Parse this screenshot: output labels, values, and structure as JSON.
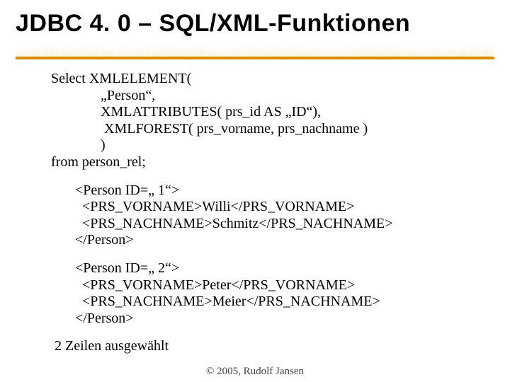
{
  "title": "JDBC 4. 0 – SQL/XML-Funktionen",
  "sql": {
    "l1": "Select XMLELEMENT(",
    "l2": "„Person“,",
    "l3": "XMLATTRIBUTES( prs_id AS „ID“),",
    "l4": " XMLFOREST( prs_vorname, prs_nachname )",
    "l5": ")",
    "l6": "from person_rel;"
  },
  "result1": {
    "open": "<Person ID=„ 1“>",
    "vor": "  <PRS_VORNAME>Willi</PRS_VORNAME>",
    "nach": "  <PRS_NACHNAME>Schmitz</PRS_NACHNAME>",
    "close": "</Person>"
  },
  "result2": {
    "open": "<Person ID=„ 2“>",
    "vor": "  <PRS_VORNAME>Peter</PRS_VORNAME>",
    "nach": "  <PRS_NACHNAME>Meier</PRS_NACHNAME>",
    "close": "</Person>"
  },
  "rowcount": " 2 Zeilen ausgewählt",
  "footer": "© 2005, Rudolf Jansen"
}
